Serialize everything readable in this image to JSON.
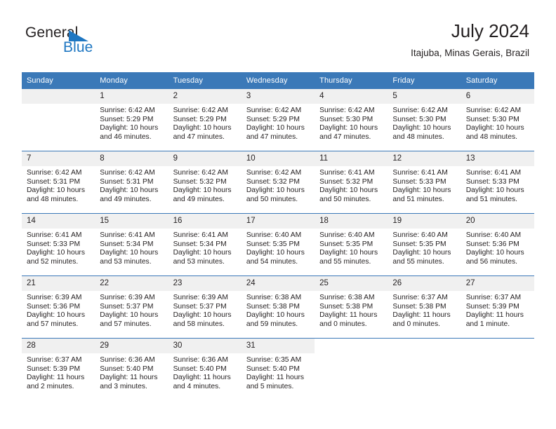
{
  "brand": {
    "name_part1": "General",
    "name_part2": "Blue",
    "triangle_icon": "triangle-right-icon",
    "accent_color": "#1f77c2"
  },
  "header": {
    "month_title": "July 2024",
    "location": "Itajuba, Minas Gerais, Brazil"
  },
  "calendar": {
    "header_bg": "#3b79b8",
    "daynum_bg": "#f0f0f0",
    "weekday_headers": [
      "Sunday",
      "Monday",
      "Tuesday",
      "Wednesday",
      "Thursday",
      "Friday",
      "Saturday"
    ],
    "weeks": [
      [
        {
          "day": "",
          "sunrise": "",
          "sunset": "",
          "daylight": "",
          "empty": true
        },
        {
          "day": "1",
          "sunrise": "Sunrise: 6:42 AM",
          "sunset": "Sunset: 5:29 PM",
          "daylight": "Daylight: 10 hours and 46 minutes."
        },
        {
          "day": "2",
          "sunrise": "Sunrise: 6:42 AM",
          "sunset": "Sunset: 5:29 PM",
          "daylight": "Daylight: 10 hours and 47 minutes."
        },
        {
          "day": "3",
          "sunrise": "Sunrise: 6:42 AM",
          "sunset": "Sunset: 5:29 PM",
          "daylight": "Daylight: 10 hours and 47 minutes."
        },
        {
          "day": "4",
          "sunrise": "Sunrise: 6:42 AM",
          "sunset": "Sunset: 5:30 PM",
          "daylight": "Daylight: 10 hours and 47 minutes."
        },
        {
          "day": "5",
          "sunrise": "Sunrise: 6:42 AM",
          "sunset": "Sunset: 5:30 PM",
          "daylight": "Daylight: 10 hours and 48 minutes."
        },
        {
          "day": "6",
          "sunrise": "Sunrise: 6:42 AM",
          "sunset": "Sunset: 5:30 PM",
          "daylight": "Daylight: 10 hours and 48 minutes."
        }
      ],
      [
        {
          "day": "7",
          "sunrise": "Sunrise: 6:42 AM",
          "sunset": "Sunset: 5:31 PM",
          "daylight": "Daylight: 10 hours and 48 minutes."
        },
        {
          "day": "8",
          "sunrise": "Sunrise: 6:42 AM",
          "sunset": "Sunset: 5:31 PM",
          "daylight": "Daylight: 10 hours and 49 minutes."
        },
        {
          "day": "9",
          "sunrise": "Sunrise: 6:42 AM",
          "sunset": "Sunset: 5:32 PM",
          "daylight": "Daylight: 10 hours and 49 minutes."
        },
        {
          "day": "10",
          "sunrise": "Sunrise: 6:42 AM",
          "sunset": "Sunset: 5:32 PM",
          "daylight": "Daylight: 10 hours and 50 minutes."
        },
        {
          "day": "11",
          "sunrise": "Sunrise: 6:41 AM",
          "sunset": "Sunset: 5:32 PM",
          "daylight": "Daylight: 10 hours and 50 minutes."
        },
        {
          "day": "12",
          "sunrise": "Sunrise: 6:41 AM",
          "sunset": "Sunset: 5:33 PM",
          "daylight": "Daylight: 10 hours and 51 minutes."
        },
        {
          "day": "13",
          "sunrise": "Sunrise: 6:41 AM",
          "sunset": "Sunset: 5:33 PM",
          "daylight": "Daylight: 10 hours and 51 minutes."
        }
      ],
      [
        {
          "day": "14",
          "sunrise": "Sunrise: 6:41 AM",
          "sunset": "Sunset: 5:33 PM",
          "daylight": "Daylight: 10 hours and 52 minutes."
        },
        {
          "day": "15",
          "sunrise": "Sunrise: 6:41 AM",
          "sunset": "Sunset: 5:34 PM",
          "daylight": "Daylight: 10 hours and 53 minutes."
        },
        {
          "day": "16",
          "sunrise": "Sunrise: 6:41 AM",
          "sunset": "Sunset: 5:34 PM",
          "daylight": "Daylight: 10 hours and 53 minutes."
        },
        {
          "day": "17",
          "sunrise": "Sunrise: 6:40 AM",
          "sunset": "Sunset: 5:35 PM",
          "daylight": "Daylight: 10 hours and 54 minutes."
        },
        {
          "day": "18",
          "sunrise": "Sunrise: 6:40 AM",
          "sunset": "Sunset: 5:35 PM",
          "daylight": "Daylight: 10 hours and 55 minutes."
        },
        {
          "day": "19",
          "sunrise": "Sunrise: 6:40 AM",
          "sunset": "Sunset: 5:35 PM",
          "daylight": "Daylight: 10 hours and 55 minutes."
        },
        {
          "day": "20",
          "sunrise": "Sunrise: 6:40 AM",
          "sunset": "Sunset: 5:36 PM",
          "daylight": "Daylight: 10 hours and 56 minutes."
        }
      ],
      [
        {
          "day": "21",
          "sunrise": "Sunrise: 6:39 AM",
          "sunset": "Sunset: 5:36 PM",
          "daylight": "Daylight: 10 hours and 57 minutes."
        },
        {
          "day": "22",
          "sunrise": "Sunrise: 6:39 AM",
          "sunset": "Sunset: 5:37 PM",
          "daylight": "Daylight: 10 hours and 57 minutes."
        },
        {
          "day": "23",
          "sunrise": "Sunrise: 6:39 AM",
          "sunset": "Sunset: 5:37 PM",
          "daylight": "Daylight: 10 hours and 58 minutes."
        },
        {
          "day": "24",
          "sunrise": "Sunrise: 6:38 AM",
          "sunset": "Sunset: 5:38 PM",
          "daylight": "Daylight: 10 hours and 59 minutes."
        },
        {
          "day": "25",
          "sunrise": "Sunrise: 6:38 AM",
          "sunset": "Sunset: 5:38 PM",
          "daylight": "Daylight: 11 hours and 0 minutes."
        },
        {
          "day": "26",
          "sunrise": "Sunrise: 6:37 AM",
          "sunset": "Sunset: 5:38 PM",
          "daylight": "Daylight: 11 hours and 0 minutes."
        },
        {
          "day": "27",
          "sunrise": "Sunrise: 6:37 AM",
          "sunset": "Sunset: 5:39 PM",
          "daylight": "Daylight: 11 hours and 1 minute."
        }
      ],
      [
        {
          "day": "28",
          "sunrise": "Sunrise: 6:37 AM",
          "sunset": "Sunset: 5:39 PM",
          "daylight": "Daylight: 11 hours and 2 minutes."
        },
        {
          "day": "29",
          "sunrise": "Sunrise: 6:36 AM",
          "sunset": "Sunset: 5:40 PM",
          "daylight": "Daylight: 11 hours and 3 minutes."
        },
        {
          "day": "30",
          "sunrise": "Sunrise: 6:36 AM",
          "sunset": "Sunset: 5:40 PM",
          "daylight": "Daylight: 11 hours and 4 minutes."
        },
        {
          "day": "31",
          "sunrise": "Sunrise: 6:35 AM",
          "sunset": "Sunset: 5:40 PM",
          "daylight": "Daylight: 11 hours and 5 minutes."
        },
        {
          "day": "",
          "sunrise": "",
          "sunset": "",
          "daylight": "",
          "blank": true
        },
        {
          "day": "",
          "sunrise": "",
          "sunset": "",
          "daylight": "",
          "blank": true
        },
        {
          "day": "",
          "sunrise": "",
          "sunset": "",
          "daylight": "",
          "blank": true
        }
      ]
    ]
  }
}
